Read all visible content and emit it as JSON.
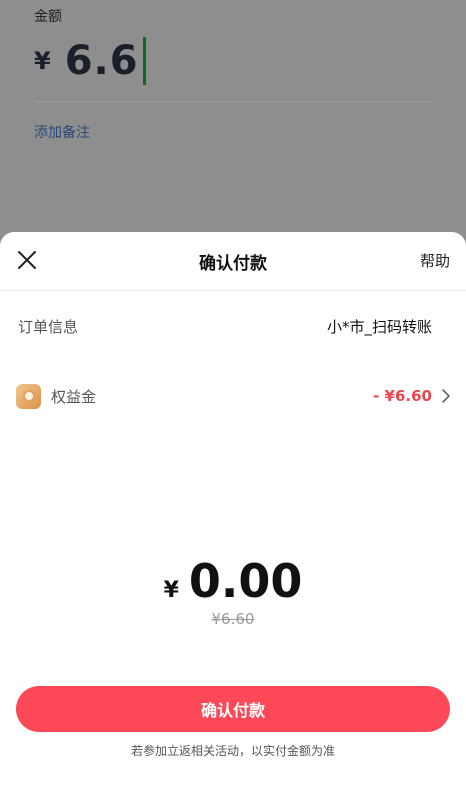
{
  "background": {
    "amount_label": "金额",
    "currency_symbol": "¥",
    "amount_value": "6.6",
    "add_note_link": "添加备注"
  },
  "sheet": {
    "title": "确认付款",
    "close_icon": "close-icon",
    "help_label": "帮助",
    "order": {
      "label": "订单信息",
      "value": "小*市_扫码转账"
    },
    "benefit": {
      "icon": "benefit-coin-icon",
      "label": "权益金",
      "amount": "- ¥6.60",
      "chevron_icon": "chevron-right-icon"
    },
    "total": {
      "currency_symbol": "¥",
      "value": "0.00",
      "original_price": "¥6.60"
    },
    "confirm_button_label": "确认付款",
    "footnote": "若参加立返相关活动，以实付金额为准"
  },
  "colors": {
    "accent": "#fd4858",
    "discount_text": "#e8474f",
    "caret": "#0e6b1a",
    "overlay": "#8e8e8e"
  }
}
